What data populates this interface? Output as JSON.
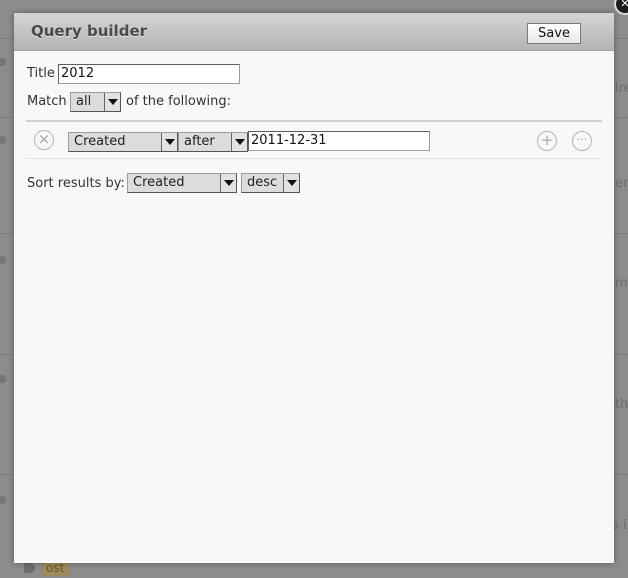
{
  "background": {
    "fragments": [
      "ire",
      "er",
      "m",
      "th",
      "s i"
    ],
    "tag_label": "ost"
  },
  "dialog": {
    "title": "Query builder",
    "save_label": "Save"
  },
  "form": {
    "title_label": "Title",
    "title_value": "2012",
    "match_label": "Match",
    "match_value": "all",
    "match_suffix": "of the following:",
    "condition": {
      "field": "Created",
      "operator": "after",
      "value": "2011-12-31"
    },
    "sort_label": "Sort results by:",
    "sort_field": "Created",
    "sort_order": "desc"
  },
  "icons": {
    "remove": "close-circle-icon",
    "add": "plus-circle-icon",
    "more": "ellipsis-circle-icon"
  }
}
